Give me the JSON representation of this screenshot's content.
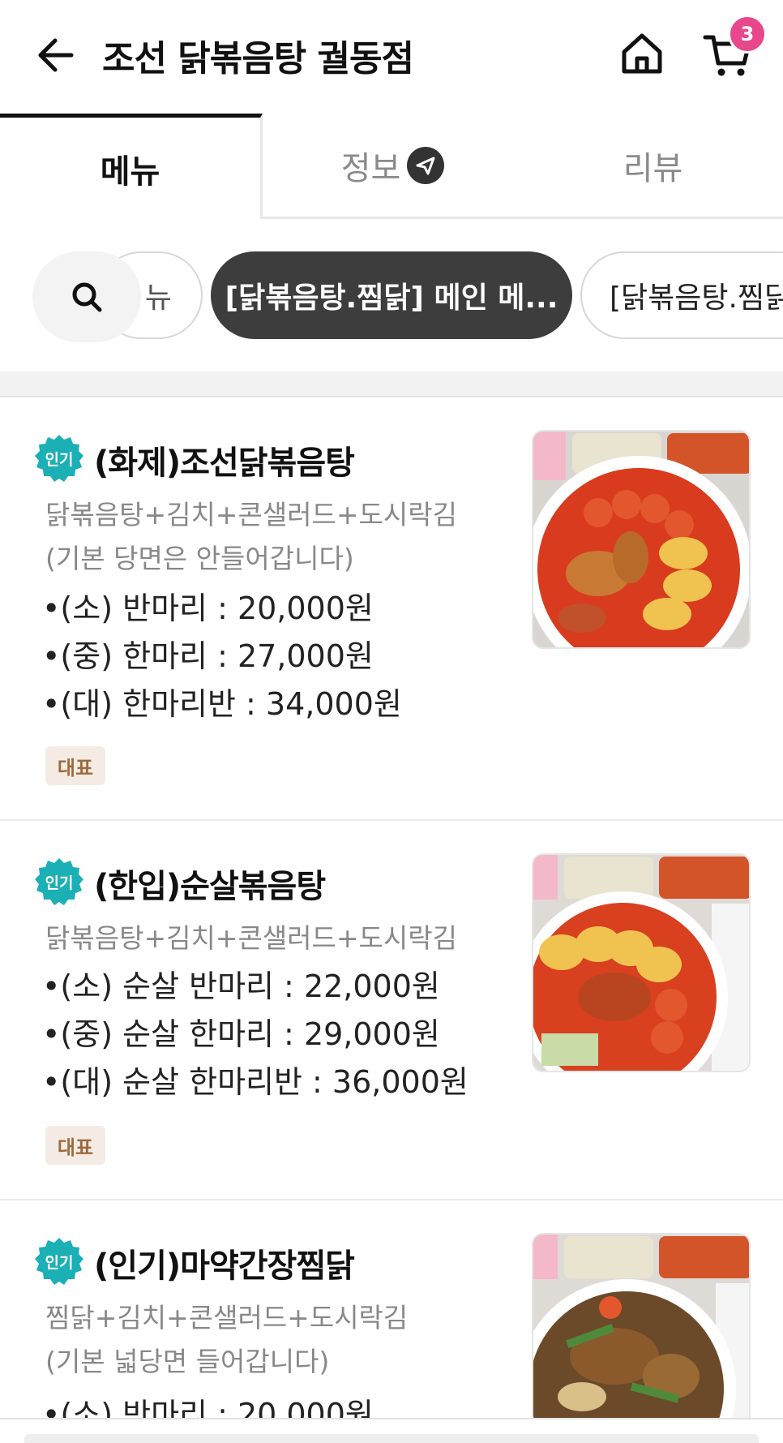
{
  "header": {
    "title": "조선 닭볶음탕 궐동점",
    "cart_count": "3"
  },
  "tabs": [
    {
      "label": "메뉴",
      "active": true
    },
    {
      "label": "정보",
      "active": false
    },
    {
      "label": "리뷰",
      "active": false
    }
  ],
  "chips": {
    "partial_label": "뉴",
    "active_label": "[닭볶음탕.찜닭] 메인 메...",
    "next_label": "[닭볶음탕.찜닭"
  },
  "menu_items": [
    {
      "badge": "인기",
      "name": "(화제)조선닭볶음탕",
      "desc": [
        "닭볶음탕+김치+콘샐러드+도시락김",
        "(기본 당면은 안들어갑니다)"
      ],
      "prices": [
        "•(소) 반마리 : 20,000원",
        "•(중) 한마리 : 27,000원",
        "•(대) 한마리반 : 34,000원"
      ],
      "tag": "대표"
    },
    {
      "badge": "인기",
      "name": "(한입)순살볶음탕",
      "desc": [
        "닭볶음탕+김치+콘샐러드+도시락김"
      ],
      "prices": [
        "•(소) 순살 반마리 : 22,000원",
        "•(중) 순살 한마리 : 29,000원",
        "•(대) 순살 한마리반 : 36,000원"
      ],
      "tag": "대표"
    },
    {
      "badge": "인기",
      "name": "(인기)마약간장찜닭",
      "desc": [
        "찜닭+김치+콘샐러드+도시락김",
        "(기본 넓당면 들어갑니다)"
      ],
      "prices": [
        "•(소) 반마리 : 20,000원"
      ]
    }
  ],
  "colors": {
    "badge_teal": "#1ab0b6",
    "cart_badge": "#e8478b",
    "active_chip": "#3d3d3d",
    "rep_tag_bg": "#f4ece4",
    "rep_tag_text": "#9c6a3e"
  },
  "icons": [
    "back-arrow-icon",
    "home-icon",
    "cart-icon",
    "search-icon",
    "send-icon"
  ]
}
